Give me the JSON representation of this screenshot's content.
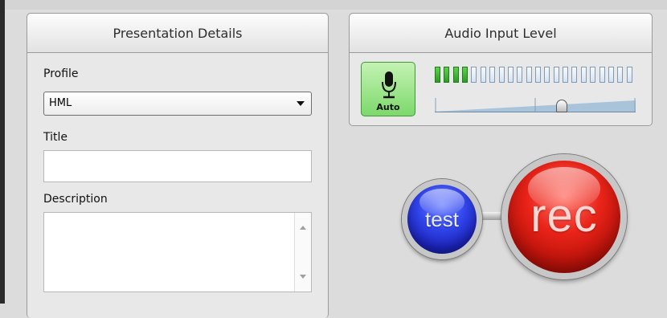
{
  "presentation": {
    "header": "Presentation Details",
    "profile_label": "Profile",
    "profile_value": "HML",
    "title_label": "Title",
    "title_value": "",
    "description_label": "Description",
    "description_value": ""
  },
  "audio": {
    "header": "Audio Input Level",
    "mic_button_label": "Auto",
    "level_meter": {
      "segments_total": 22,
      "segments_lit": 4
    },
    "gain_slider": {
      "value": 0.63
    },
    "colors": {
      "mic_button": "#7cd96a",
      "meter_lit": "#2a9c24"
    }
  },
  "controls": {
    "test_label": "test",
    "rec_label": "rec",
    "colors": {
      "test": "#3347ee",
      "rec": "#ea2419"
    }
  }
}
